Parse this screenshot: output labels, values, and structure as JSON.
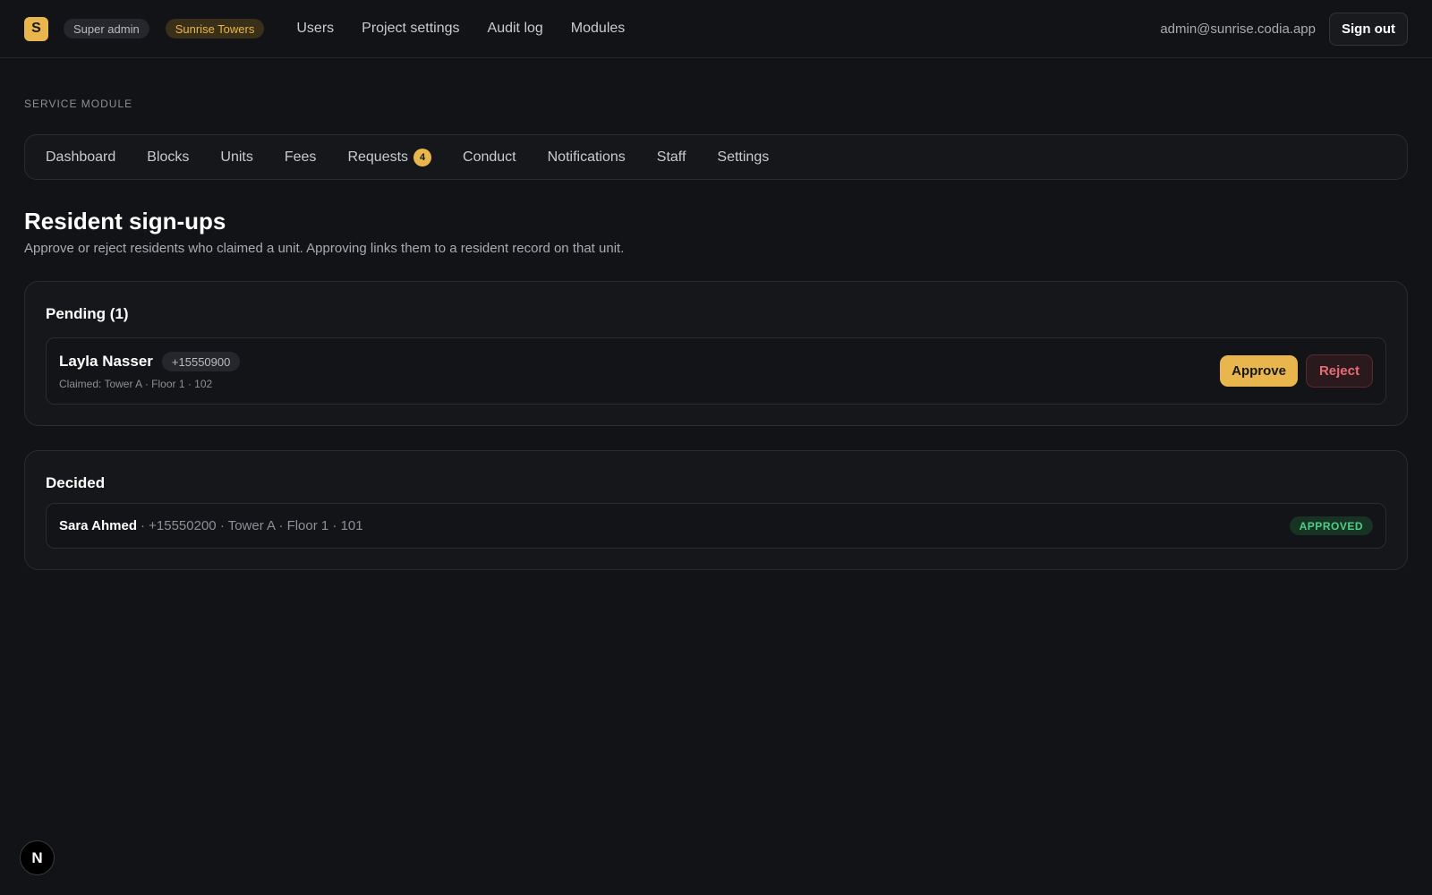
{
  "header": {
    "logo_letter": "S",
    "role_badge": "Super admin",
    "project_badge": "Sunrise Towers",
    "nav": [
      "Users",
      "Project settings",
      "Audit log",
      "Modules"
    ],
    "user_email": "admin@sunrise.codia.app",
    "sign_out_label": "Sign out"
  },
  "module": {
    "eyebrow": "Service module",
    "tabs": [
      {
        "label": "Dashboard"
      },
      {
        "label": "Blocks"
      },
      {
        "label": "Units"
      },
      {
        "label": "Fees"
      },
      {
        "label": "Requests",
        "badge": "4"
      },
      {
        "label": "Conduct"
      },
      {
        "label": "Notifications"
      },
      {
        "label": "Staff"
      },
      {
        "label": "Settings"
      }
    ]
  },
  "page": {
    "title": "Resident sign-ups",
    "subtitle": "Approve or reject residents who claimed a unit. Approving links them to a resident record on that unit."
  },
  "pending": {
    "title": "Pending (1)",
    "items": [
      {
        "name": "Layla Nasser",
        "phone": "+15550900",
        "claimed": "Claimed: Tower A · Floor 1 · 102",
        "approve_label": "Approve",
        "reject_label": "Reject"
      }
    ]
  },
  "decided": {
    "title": "Decided",
    "items": [
      {
        "name": "Sara Ahmed",
        "meta": "· +15550200 · Tower A · Floor 1 · 101",
        "status": "APPROVED"
      }
    ]
  },
  "dev_indicator": "N",
  "colors": {
    "accent": "#e8b64c",
    "danger": "#e76c74",
    "success": "#4fcf86",
    "background": "#121316"
  }
}
